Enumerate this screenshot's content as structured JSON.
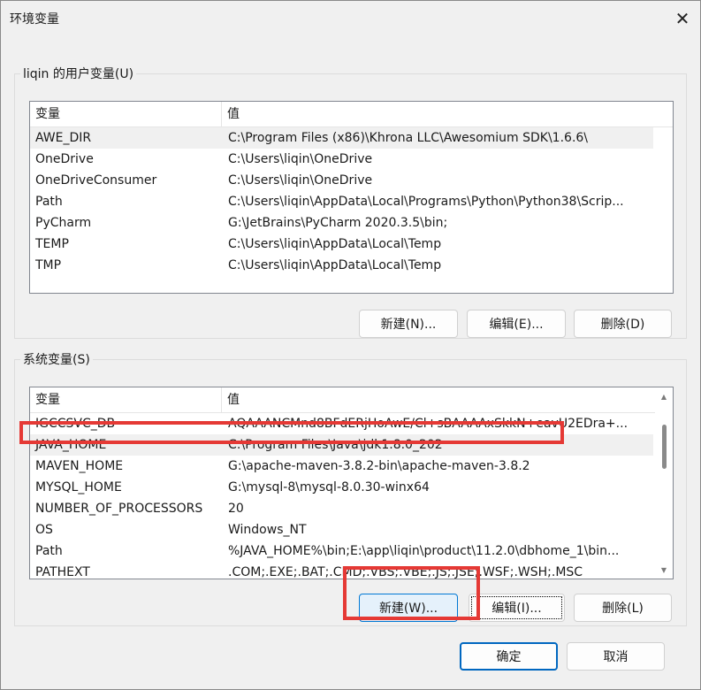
{
  "window": {
    "title": "环境变量",
    "close_glyph": "✕"
  },
  "user_section": {
    "legend": "liqin 的用户变量(U)",
    "columns": [
      "变量",
      "值"
    ],
    "rows": [
      {
        "name": "AWE_DIR",
        "value": "C:\\Program Files (x86)\\Khrona LLC\\Awesomium SDK\\1.6.6\\"
      },
      {
        "name": "OneDrive",
        "value": "C:\\Users\\liqin\\OneDrive"
      },
      {
        "name": "OneDriveConsumer",
        "value": "C:\\Users\\liqin\\OneDrive"
      },
      {
        "name": "Path",
        "value": "C:\\Users\\liqin\\AppData\\Local\\Programs\\Python\\Python38\\Scrip..."
      },
      {
        "name": "PyCharm",
        "value": "G:\\JetBrains\\PyCharm 2020.3.5\\bin;"
      },
      {
        "name": "TEMP",
        "value": "C:\\Users\\liqin\\AppData\\Local\\Temp"
      },
      {
        "name": "TMP",
        "value": "C:\\Users\\liqin\\AppData\\Local\\Temp"
      }
    ],
    "buttons": {
      "new": "新建(N)...",
      "edit": "编辑(E)...",
      "delete": "删除(D)"
    }
  },
  "system_section": {
    "legend": "系统变量(S)",
    "columns": [
      "变量",
      "值"
    ],
    "rows": [
      {
        "name": "IGCCSVC_DB",
        "value": "AQAAANCMnd8BFdERjHoAwE/Cl+sBAAAAxSkkN+eavU2EDra+..."
      },
      {
        "name": "JAVA_HOME",
        "value": "C:\\Program Files\\Java\\jdk1.8.0_202"
      },
      {
        "name": "MAVEN_HOME",
        "value": "G:\\apache-maven-3.8.2-bin\\apache-maven-3.8.2"
      },
      {
        "name": "MYSQL_HOME",
        "value": "G:\\mysql-8\\mysql-8.0.30-winx64"
      },
      {
        "name": "NUMBER_OF_PROCESSORS",
        "value": "20"
      },
      {
        "name": "OS",
        "value": "Windows_NT"
      },
      {
        "name": "Path",
        "value": "%JAVA_HOME%\\bin;E:\\app\\liqin\\product\\11.2.0\\dbhome_1\\bin..."
      },
      {
        "name": "PATHEXT",
        "value": ".COM;.EXE;.BAT;.CMD;.VBS;.VBE;.JS;.JSE;.WSF;.WSH;.MSC"
      }
    ],
    "buttons": {
      "new": "新建(W)...",
      "edit": "编辑(I)...",
      "delete": "删除(L)"
    }
  },
  "footer": {
    "ok": "确定",
    "cancel": "取消"
  },
  "colors": {
    "highlight_box": "#e53935",
    "primary_border": "#0067c0"
  }
}
